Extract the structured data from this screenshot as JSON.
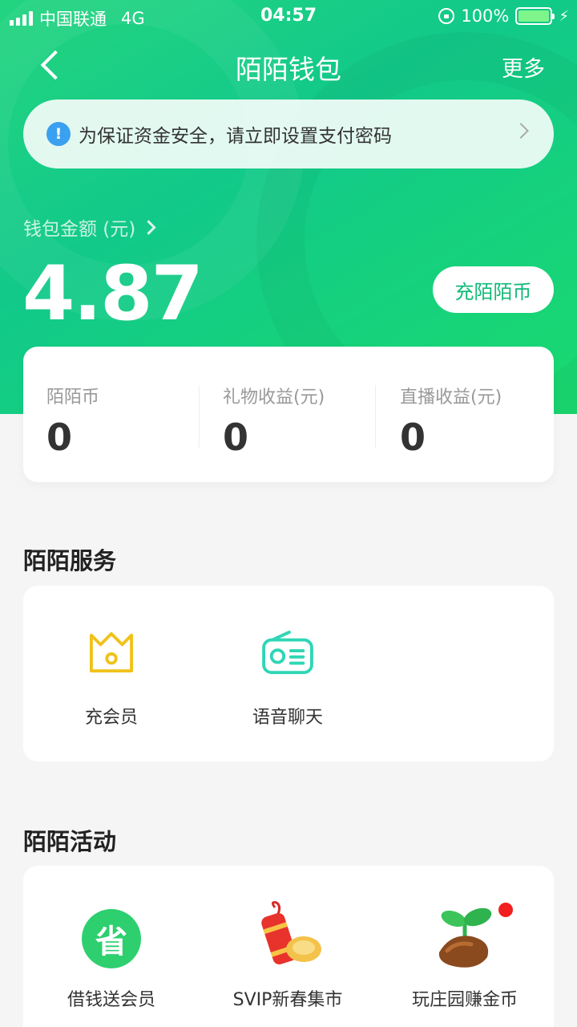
{
  "status_bar": {
    "carrier": "中国联通",
    "network": "4G",
    "time": "04:57",
    "battery": "100%"
  },
  "nav": {
    "title": "陌陌钱包",
    "more": "更多"
  },
  "notice": {
    "text": "为保证资金安全，请立即设置支付密码",
    "icon": "info-icon"
  },
  "balance": {
    "label": "钱包金额 (元)",
    "value": "4.87",
    "recharge_button": "充陌陌币"
  },
  "stats": [
    {
      "label": "陌陌币",
      "value": "0"
    },
    {
      "label": "礼物收益(元)",
      "value": "0"
    },
    {
      "label": "直播收益(元)",
      "value": "0"
    }
  ],
  "services": {
    "title": "陌陌服务",
    "items": [
      {
        "label": "充会员",
        "icon": "crown-icon"
      },
      {
        "label": "语音聊天",
        "icon": "radio-icon"
      }
    ]
  },
  "activities": {
    "title": "陌陌活动",
    "items": [
      {
        "label": "借钱送会员",
        "icon": "save-money-icon"
      },
      {
        "label": "SVIP新春集市",
        "icon": "firecracker-icon"
      },
      {
        "label": "玩庄园赚金币",
        "icon": "sprout-icon"
      }
    ]
  },
  "colors": {
    "primary_green": "#12c98a",
    "recharge_text": "#12b979",
    "crown_yellow": "#f0c21a",
    "radio_teal": "#2fd6b5",
    "info_blue": "#3aa0f0",
    "badge_red": "#f21f1f"
  }
}
